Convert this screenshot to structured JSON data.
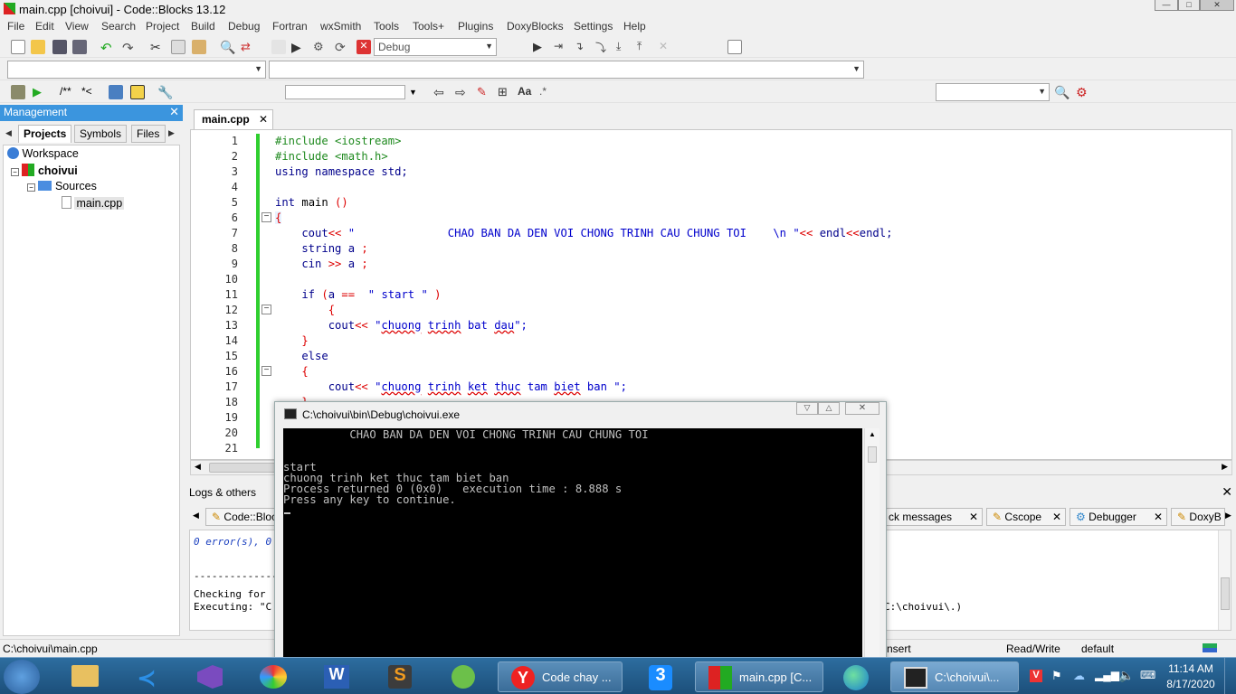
{
  "window": {
    "title": "main.cpp [choivui] - Code::Blocks 13.12"
  },
  "menu": [
    "File",
    "Edit",
    "View",
    "Search",
    "Project",
    "Build",
    "Debug",
    "Fortran",
    "wxSmith",
    "Tools",
    "Tools+",
    "Plugins",
    "DoxyBlocks",
    "Settings",
    "Help"
  ],
  "toolbar": {
    "build_target": "Debug"
  },
  "management": {
    "title": "Management",
    "tabs": [
      "Projects",
      "Symbols",
      "Files"
    ],
    "tree": {
      "workspace": "Workspace",
      "project": "choivui",
      "folder": "Sources",
      "file": "main.cpp"
    }
  },
  "editor": {
    "tab": "main.cpp",
    "line_numbers": [
      "1",
      "2",
      "3",
      "4",
      "5",
      "6",
      "7",
      "8",
      "9",
      "10",
      "11",
      "12",
      "13",
      "14",
      "15",
      "16",
      "17",
      "18",
      "19",
      "20",
      "21"
    ]
  },
  "code": {
    "l1": "#include <iostream>",
    "l2": "#include <math.h>",
    "l3_kw": "using namespace",
    "l3_rest": " std;",
    "l5_kw": "int",
    "l5_rest": " main ",
    "l5_op": "()",
    "l6": "{",
    "l7_a": "    cout",
    "l7_b": "<< ",
    "l7_str": "\"              CHAO BAN DA DEN VOI CHONG TRINH CAU CHUNG TOI    \\n \"",
    "l7_c": "<< ",
    "l7_d": "endl",
    "l7_e": "<<",
    "l7_f": "endl;",
    "l8_kw": "    string",
    "l8_rest": " a ",
    "l8_op": ";",
    "l9_kw": "    cin",
    "l9_op": " >>",
    "l9_rest": " a ",
    "l9_op2": ";",
    "l11_kw": "    if",
    "l11_op": " (",
    "l11_a": "a ",
    "l11_eq": "==",
    "l11_str": "  \" start \"",
    "l11_cl": " )",
    "l12": "        {",
    "l13_a": "        cout",
    "l13_b": "<< ",
    "l13_q": "\"",
    "l13_w1": "chuong",
    "l13_w2": "trinh",
    "l13_w3": "bat",
    "l13_w4": "dau",
    "l13_end": "\";",
    "l14": "    }",
    "l15": "    else",
    "l16": "    {",
    "l17_a": "        cout",
    "l17_b": "<< ",
    "l17_q": "\"",
    "l17_w1": "chuong",
    "l17_w2": "trinh",
    "l17_w3": "ket",
    "l17_w4": "thuc",
    "l17_rest": " tam ",
    "l17_w5": "biet",
    "l17_end": " ban \";",
    "l18": "    }"
  },
  "console": {
    "title": "C:\\choivui\\bin\\Debug\\choivui.exe",
    "lines": [
      "          CHAO BAN DA DEN VOI CHONG TRINH CAU CHUNG TOI",
      "",
      "start",
      "chuong trinh ket thuc tam biet ban",
      "Process returned 0 (0x0)   execution time : 8.888 s",
      "Press any key to continue."
    ]
  },
  "logs": {
    "title": "Logs & others",
    "tabs": [
      "Code::Blocks",
      "ck messages",
      "Cscope",
      "Debugger",
      "DoxyB"
    ],
    "line1": "0 error(s), 0",
    "line2": "---------------",
    "line3": "Checking for",
    "line4": "Executing: \"C",
    "line4_right": "C:\\choivui\\.)"
  },
  "status": {
    "path": "C:\\choivui\\main.cpp",
    "mode": "nsert",
    "rw": "Read/Write",
    "profile": "default"
  },
  "taskbar": {
    "win_yandex": "Code chay ...",
    "win_codeblocks": "main.cpp [C...",
    "win_console": "C:\\choivui\\...",
    "time": "11:14 AM",
    "date": "8/17/2020"
  },
  "colors": {
    "accent": "#3b95de",
    "changebar": "#2fcf2f",
    "taskbar": "#1c4f7a"
  }
}
